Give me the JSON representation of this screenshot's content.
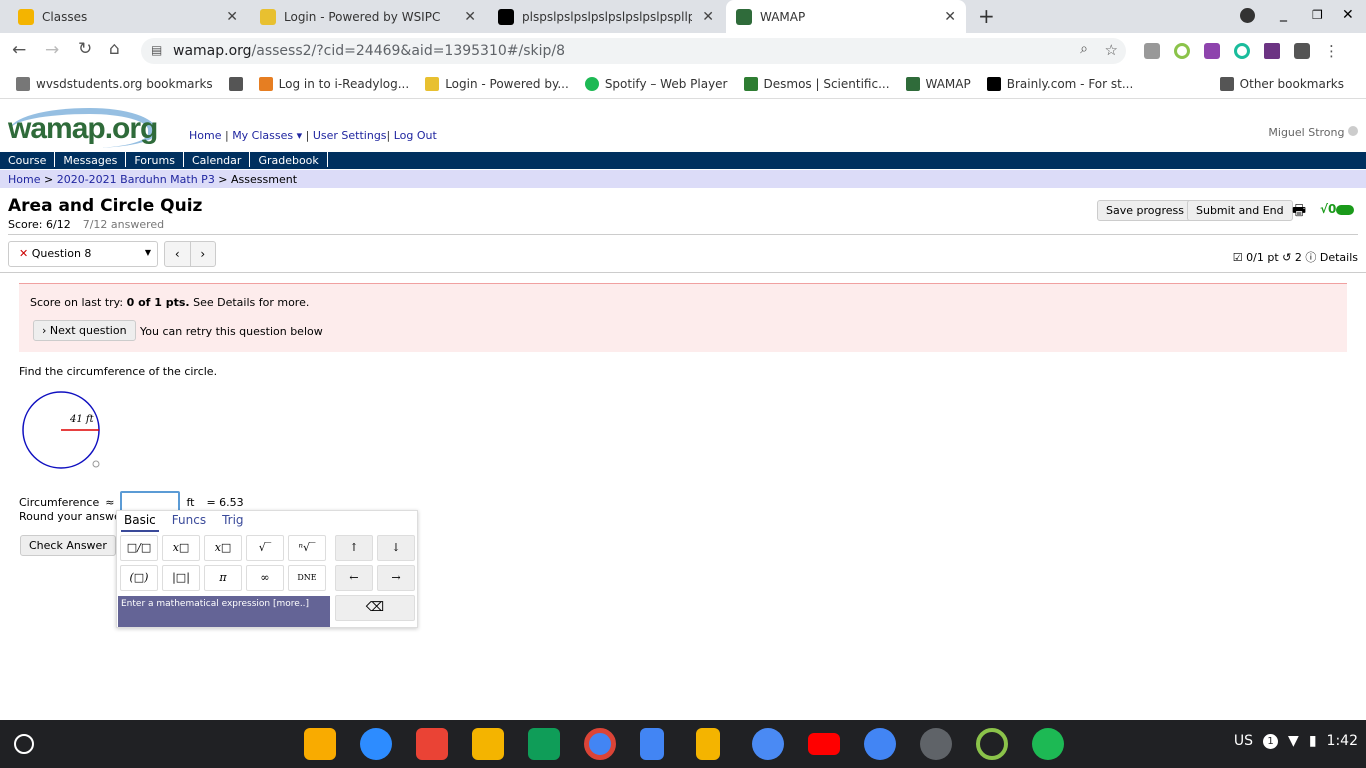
{
  "browser": {
    "tabs": [
      {
        "title": "Classes",
        "color": "#f4b400"
      },
      {
        "title": "Login - Powered by WSIPC",
        "color": "#e8c030"
      },
      {
        "title": "plspslpslpslpslpslpslpslpspllp",
        "color": "#000000"
      },
      {
        "title": "WAMAP",
        "color": "#2f6b3a",
        "active": true
      }
    ],
    "url_host": "wamap.org",
    "url_path": "/assess2/?cid=24469&aid=1395310#/skip/8",
    "bookmarks": [
      "wvsdstudents.org bookmarks",
      "",
      "Log in to i-Readylog...",
      "Login - Powered by...",
      "Spotify – Web Player",
      "Desmos | Scientific...",
      "WAMAP",
      "Brainly.com - For st..."
    ],
    "other_bookmarks": "Other bookmarks"
  },
  "site": {
    "logo": "wamap.org",
    "topnav": [
      "Home",
      "My Classes ▾",
      "User Settings",
      "Log Out"
    ],
    "user": "Miguel Strong",
    "nav": [
      "Course",
      "Messages",
      "Forums",
      "Calendar",
      "Gradebook"
    ],
    "breadcrumb": {
      "home": "Home",
      "course": "2020-2021 Barduhn Math P3",
      "current": "Assessment"
    }
  },
  "quiz": {
    "title": "Area and Circle Quiz",
    "score": "Score: 6/12",
    "answered": "7/12 answered",
    "save": "Save progress",
    "submit": "Submit and End",
    "question_select": "Question 8",
    "points": "0/1 pt",
    "retries": "2",
    "details": "Details",
    "notice_text": "Score on last try: ",
    "notice_bold": "0 of 1 pts.",
    "notice_after": " See Details for more.",
    "next_question": "Next question",
    "retry_text": "You can retry this question below",
    "prompt": "Find the circumference of the circle.",
    "radius_label": "41 ft",
    "answer_label": "Circumference",
    "approx": "≈",
    "answer_value": "",
    "unit": "ft",
    "preview": "= 6.53",
    "round_text": "Round your answer t",
    "check": "Check Answer"
  },
  "keyboard": {
    "tabs": [
      "Basic",
      "Funcs",
      "Trig"
    ],
    "keys_row1": [
      "□/□",
      "x□",
      "x□",
      "√‾",
      "ⁿ√‾"
    ],
    "keys_row2": [
      "(□)",
      "|□|",
      "π",
      "∞",
      "DNE"
    ],
    "arrows": [
      "↑",
      "↓",
      "←",
      "→"
    ],
    "backspace": "⌫",
    "help": "Enter a mathematical expression [more..]"
  },
  "taskbar": {
    "locale": "US",
    "notif": "1",
    "time": "1:42"
  }
}
